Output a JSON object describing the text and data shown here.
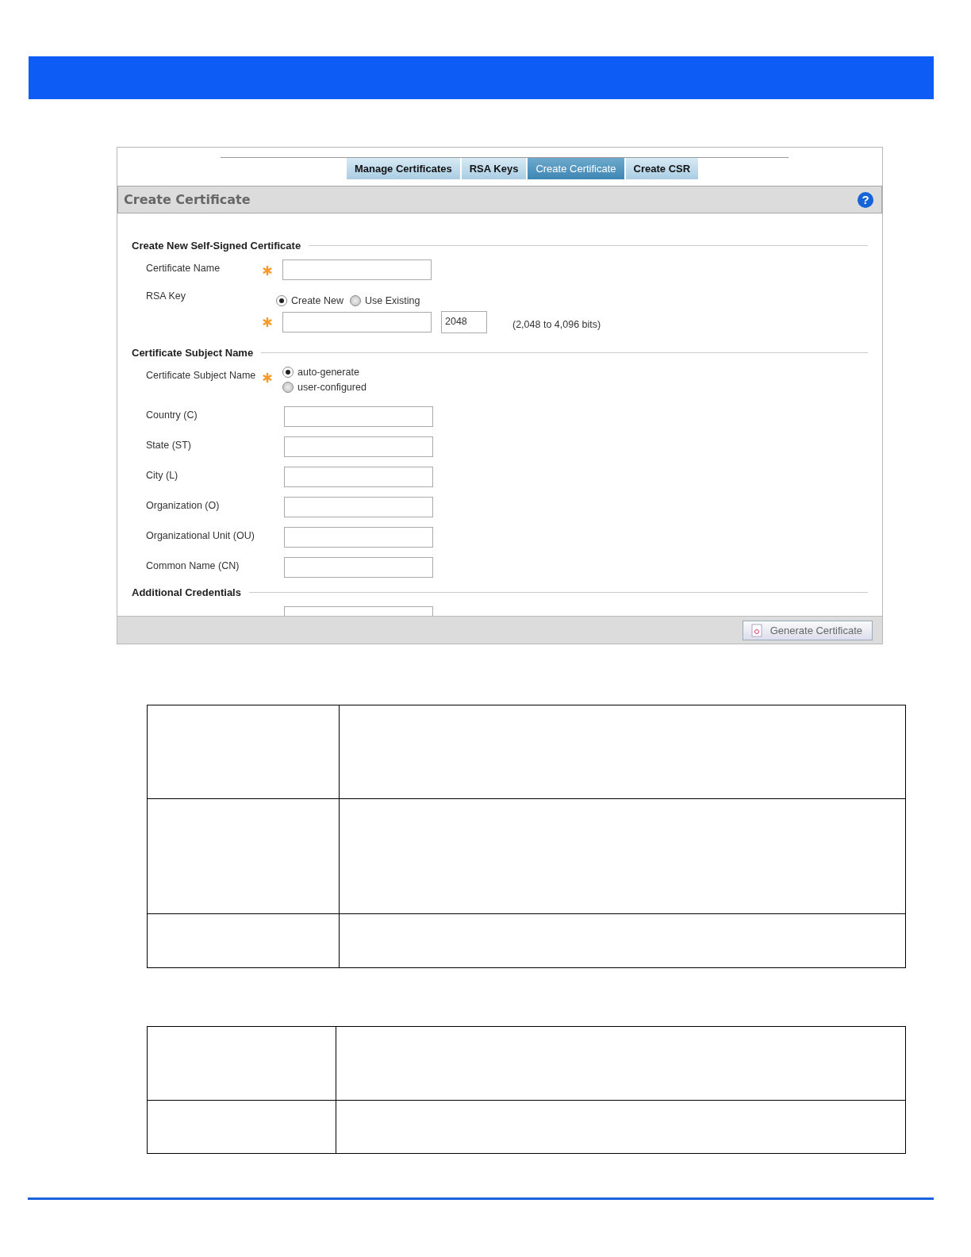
{
  "tabs": [
    {
      "label": "Manage Certificates",
      "selected": false
    },
    {
      "label": "RSA Keys",
      "selected": false
    },
    {
      "label": "Create Certificate",
      "selected": true
    },
    {
      "label": "Create CSR",
      "selected": false
    }
  ],
  "panel": {
    "title": "Create Certificate",
    "help": "?"
  },
  "sections": [
    {
      "title": "Create New Self-Signed Certificate",
      "rows": [
        {
          "kind": "text",
          "label": "Certificate Name",
          "required": true
        },
        {
          "kind": "radio",
          "label": "RSA Key",
          "options": [
            {
              "label": "Create New",
              "selected": true
            },
            {
              "label": "Use Existing",
              "selected": false
            }
          ]
        },
        {
          "kind": "key",
          "required": true,
          "value": "2048",
          "hint": "(2,048 to 4,096 bits)"
        }
      ]
    },
    {
      "title": "Certificate Subject Name",
      "rows": [
        {
          "kind": "radio-stack",
          "label": "Certificate Subject Name",
          "required": true,
          "options": [
            {
              "label": "auto-generate",
              "selected": true
            },
            {
              "label": "user-configured",
              "selected": false
            }
          ]
        },
        {
          "kind": "text",
          "label": "Country (C)",
          "required": false
        },
        {
          "kind": "text",
          "label": "State (ST)",
          "required": false
        },
        {
          "kind": "text",
          "label": "City (L)",
          "required": false
        },
        {
          "kind": "text",
          "label": "Organization (O)",
          "required": false
        },
        {
          "kind": "text",
          "label": "Organizational Unit (OU)",
          "required": false
        },
        {
          "kind": "text",
          "label": "Common Name (CN)",
          "required": false
        }
      ]
    },
    {
      "title": "Additional Credentials",
      "rows": [
        {
          "kind": "text",
          "required": false
        }
      ]
    }
  ],
  "footer": {
    "button": "Generate Certificate"
  }
}
